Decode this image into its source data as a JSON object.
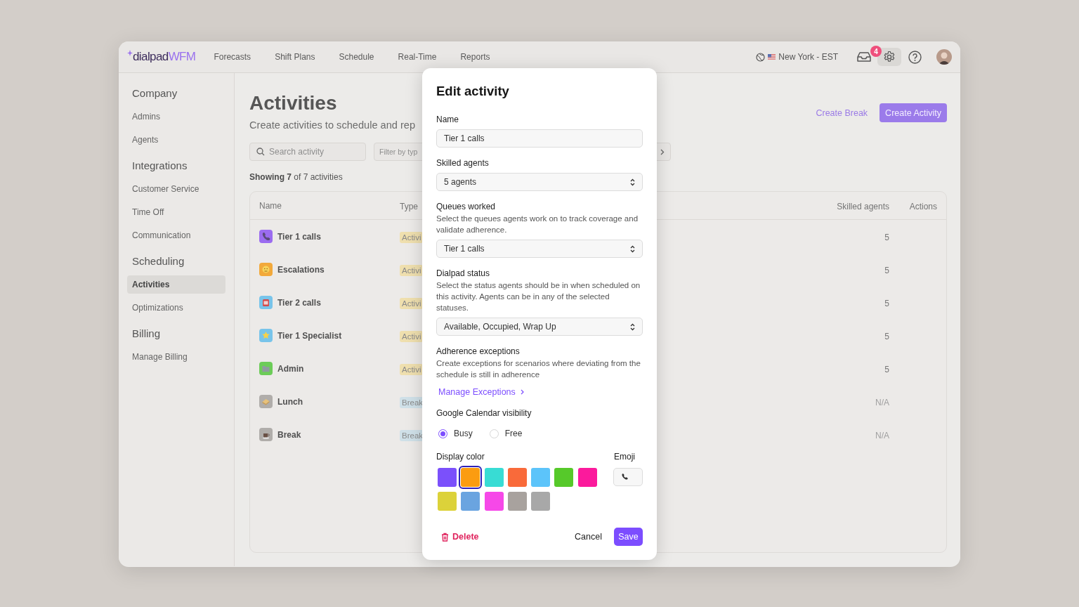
{
  "topbar": {
    "logo": {
      "brand": "dialpad",
      "product": "WFM"
    },
    "nav": [
      {
        "label": "Forecasts"
      },
      {
        "label": "Shift Plans"
      },
      {
        "label": "Schedule"
      },
      {
        "label": "Real-Time"
      },
      {
        "label": "Reports"
      }
    ],
    "timezone": "New York - EST",
    "inbox_badge": "4"
  },
  "sidebar": {
    "sections": [
      {
        "title": "Company",
        "items": [
          {
            "label": "Admins",
            "selected": false
          },
          {
            "label": "Agents",
            "selected": false
          }
        ]
      },
      {
        "title": "Integrations",
        "items": [
          {
            "label": "Customer Service",
            "selected": false
          },
          {
            "label": "Time Off",
            "selected": false
          },
          {
            "label": "Communication",
            "selected": false
          }
        ]
      },
      {
        "title": "Scheduling",
        "items": [
          {
            "label": "Activities",
            "selected": true
          },
          {
            "label": "Optimizations",
            "selected": false
          }
        ]
      },
      {
        "title": "Billing",
        "items": [
          {
            "label": "Manage Billing",
            "selected": false
          }
        ]
      }
    ]
  },
  "page": {
    "title": "Activities",
    "subtitle": "Create activities to schedule and rep",
    "actions": [
      {
        "label": "Create Break",
        "kind": "link"
      },
      {
        "label": "Create Activity",
        "kind": "primary"
      }
    ],
    "search": {
      "placeholder": "Search activity"
    },
    "filter": {
      "placeholder": "Filter by typ"
    },
    "showing": "**Showing 7** of 7 activities"
  },
  "table": {
    "columns": [
      "Name",
      "Type",
      "Skilled agents",
      "Actions"
    ],
    "rows": [
      {
        "name": "Tier 1 calls",
        "color": "#9b6cf0",
        "type": {
          "label": "Activi",
          "kind": "activity"
        },
        "skilled_agents": "5"
      },
      {
        "name": "Escalations",
        "color": "#f2a93b",
        "type": {
          "label": "Activi",
          "kind": "activity"
        },
        "skilled_agents": "5"
      },
      {
        "name": "Tier 2 calls",
        "color": "#78c4ea",
        "type": {
          "label": "Activi",
          "kind": "activity"
        },
        "skilled_agents": "5"
      },
      {
        "name": "Tier 1 Specialist",
        "color": "#78c4ea",
        "type": {
          "label": "Activi",
          "kind": "activity"
        },
        "skilled_agents": "5"
      },
      {
        "name": "Admin",
        "color": "#6ccc58",
        "type": {
          "label": "Activi",
          "kind": "activity"
        },
        "skilled_agents": "5"
      },
      {
        "name": "Lunch",
        "color": "#b0adaa",
        "type": {
          "label": "Break",
          "kind": "break"
        },
        "skilled_agents": "N/A"
      },
      {
        "name": "Break",
        "color": "#b0adaa",
        "type": {
          "label": "Break",
          "kind": "break"
        },
        "skilled_agents": "N/A"
      }
    ]
  },
  "modal": {
    "title": "Edit activity",
    "name_field": {
      "label": "Name",
      "value": "Tier 1 calls"
    },
    "skilled_agents": {
      "label": "Skilled agents",
      "value": "5 agents"
    },
    "queues": {
      "label": "Queues worked",
      "description": "Select the queues agents work on to track coverage and validate adherence.",
      "value": "Tier 1 calls"
    },
    "dialpad_status": {
      "label": "Dialpad status",
      "description": "Select the status agents should be in when scheduled on this activity. Agents can be in any of the selected statuses.",
      "value": "Available, Occupied, Wrap Up"
    },
    "adherence": {
      "label": "Adherence exceptions",
      "description": "Create exceptions for scenarios where deviating from the schedule is still in adherence",
      "link": "Manage Exceptions"
    },
    "calendar": {
      "label": "Google Calendar visibility",
      "options": [
        {
          "label": "Busy",
          "selected": true
        },
        {
          "label": "Free",
          "selected": false
        }
      ]
    },
    "display_color": {
      "label": "Display color",
      "swatches": [
        {
          "color": "#7b50fb",
          "selected": false
        },
        {
          "color": "#fb9c10",
          "selected": true
        },
        {
          "color": "#38dcd4",
          "selected": false
        },
        {
          "color": "#f96a3a",
          "selected": false
        },
        {
          "color": "#5cc4fa",
          "selected": false
        },
        {
          "color": "#56c92a",
          "selected": false
        },
        {
          "color": "#fb1a9c",
          "selected": false
        },
        {
          "color": "#dcd23a",
          "selected": false
        },
        {
          "color": "#6aa4e0",
          "selected": false
        },
        {
          "color": "#f648e8",
          "selected": false
        },
        {
          "color": "#a8a29e",
          "selected": false
        },
        {
          "color": "#a8a8a8",
          "selected": false
        }
      ]
    },
    "emoji": {
      "label": "Emoji"
    },
    "buttons": {
      "delete": "Delete",
      "cancel": "Cancel",
      "save": "Save"
    }
  }
}
